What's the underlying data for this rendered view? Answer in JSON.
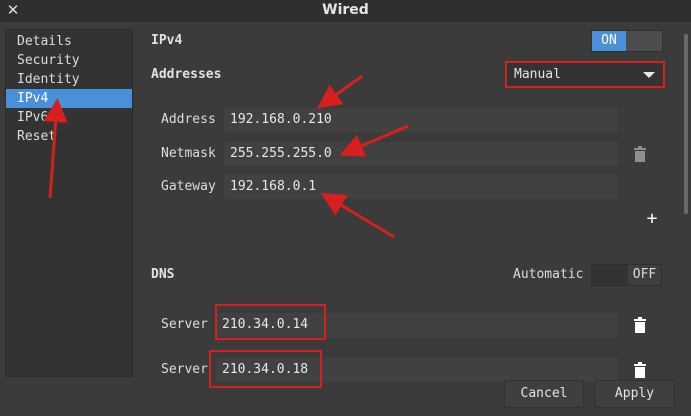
{
  "window": {
    "title": "Wired"
  },
  "sidebar": {
    "items": [
      {
        "label": "Details"
      },
      {
        "label": "Security"
      },
      {
        "label": "Identity"
      },
      {
        "label": "IPv4"
      },
      {
        "label": "IPv6"
      },
      {
        "label": "Reset"
      }
    ]
  },
  "ipv4": {
    "heading": "IPv4",
    "toggle_label": "ON",
    "addresses_heading": "Addresses",
    "method": "Manual",
    "address_label": "Address",
    "address_value": "192.168.0.210",
    "netmask_label": "Netmask",
    "netmask_value": "255.255.255.0",
    "gateway_label": "Gateway",
    "gateway_value": "192.168.0.1",
    "add_symbol": "+"
  },
  "dns": {
    "heading": "DNS",
    "automatic_label": "Automatic",
    "automatic_state": "OFF",
    "servers": [
      {
        "label": "Server",
        "value": "210.34.0.14"
      },
      {
        "label": "Server",
        "value": "210.34.0.18"
      }
    ]
  },
  "buttons": {
    "cancel": "Cancel",
    "apply": "Apply"
  },
  "colors": {
    "accent": "#4a90d9",
    "annotation": "#d61f1f",
    "background": "#3b3b3b"
  }
}
